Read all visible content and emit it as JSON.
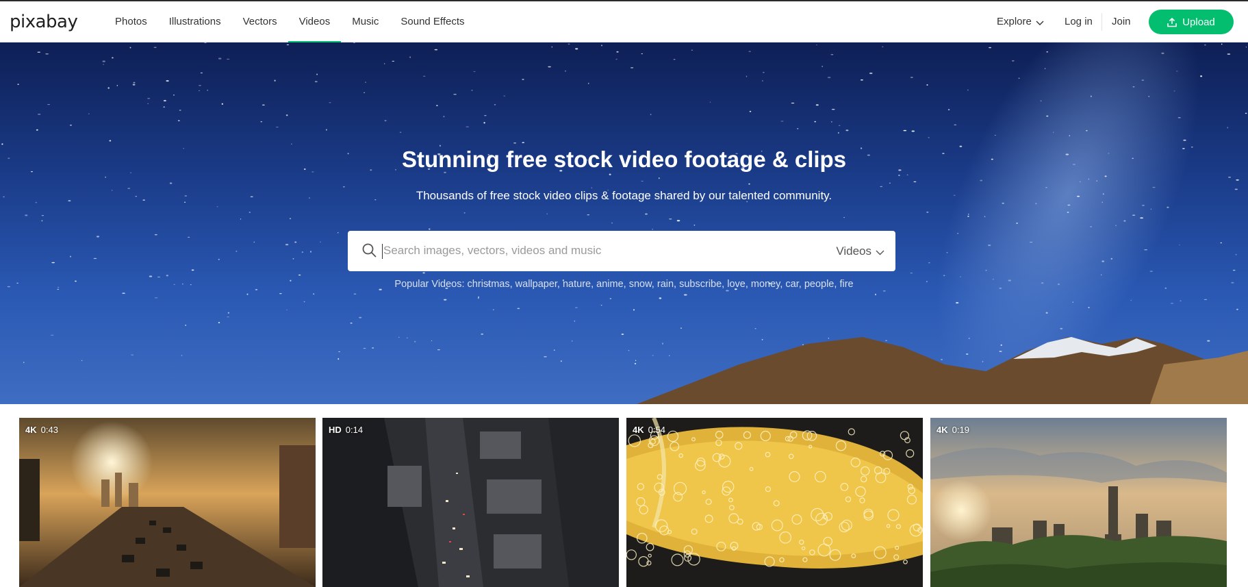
{
  "header": {
    "logo": "pixabay",
    "nav": [
      {
        "label": "Photos",
        "active": false
      },
      {
        "label": "Illustrations",
        "active": false
      },
      {
        "label": "Vectors",
        "active": false
      },
      {
        "label": "Videos",
        "active": true
      },
      {
        "label": "Music",
        "active": false
      },
      {
        "label": "Sound Effects",
        "active": false
      }
    ],
    "explore_label": "Explore",
    "login_label": "Log in",
    "join_label": "Join",
    "upload_label": "Upload"
  },
  "hero": {
    "title": "Stunning free stock video footage & clips",
    "subtitle": "Thousands of free stock video clips & footage shared by our talented community.",
    "search": {
      "placeholder": "Search images, vectors, videos and music",
      "value": "",
      "type_label": "Videos"
    },
    "popular": {
      "label": "Popular Videos:",
      "tags": [
        "christmas",
        "wallpaper",
        "nature",
        "anime",
        "snow",
        "rain",
        "subscribe",
        "love",
        "money",
        "car",
        "people",
        "fire"
      ]
    }
  },
  "videos": [
    {
      "quality": "4K",
      "duration": "0:43"
    },
    {
      "quality": "HD",
      "duration": "0:14"
    },
    {
      "quality": "4K",
      "duration": "0:54"
    },
    {
      "quality": "4K",
      "duration": "0:19"
    }
  ],
  "colors": {
    "accent": "#02be6e",
    "text": "#333333"
  }
}
